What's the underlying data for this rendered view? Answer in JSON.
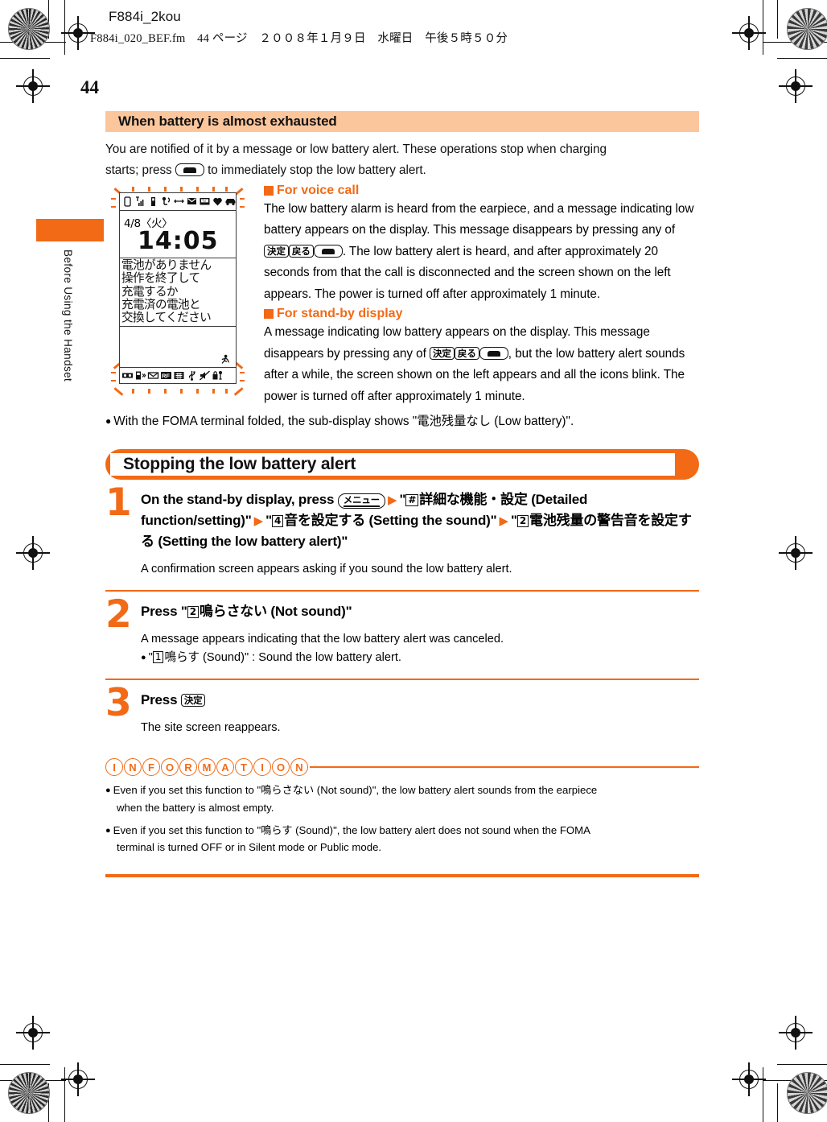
{
  "print_header": {
    "job_name": "F884i_2kou",
    "file_line": "F884i_020_BEF.fm　44 ページ　２００８年１月９日　水曜日　午後５時５０分"
  },
  "folio": "44",
  "sidebar": {
    "chapter_label": "Before Using the Handset",
    "tab_color": "#f26a16"
  },
  "section_a": {
    "heading": "When battery is almost exhausted",
    "heading_bg": "#fcc69c",
    "intro_1": "You are notified of it by a message or low battery alert. These operations stop when charging",
    "intro_2a": "starts; press",
    "intro_2b": "to immediately stop the low battery alert.",
    "sub1": {
      "title": "For voice call",
      "text_a": "The low battery alarm is heard from the earpiece, and a message indicating low battery appears on the display. This message disappears by pressing any of",
      "key1": "決定",
      "key2": "戻る",
      "text_b": ". The low battery alert is heard, and after approximately 20 seconds from that the call is disconnected and the screen shown on the left appears. The power is turned off after approximately 1 minute."
    },
    "sub2": {
      "title": "For stand-by display",
      "text_a": "A message indicating low battery appears on the display. This message disappears by pressing any of",
      "key1": "決定",
      "key2": "戻る",
      "text_b": ", but the low battery alert sounds after a while, the screen shown on the left appears and all the icons blink. The power is turned off after approximately 1 minute."
    },
    "note": "With the FOMA terminal folded, the sub-display shows \"電池残量なし (Low battery)\"."
  },
  "phone_screen": {
    "date": "4/8〈火〉",
    "time": "14:05",
    "message_lines": [
      "電池がありません",
      "操作を終了して",
      "充電するか",
      "充電済の電池と",
      "交換してください"
    ],
    "status_icons": [
      "battery-icon",
      "signal-bars-icon",
      "vibrate-icon",
      "earphone-icon",
      "transfer-icon",
      "mail-icon",
      "tv-icon",
      "heart-icon",
      "car-icon"
    ],
    "soft_icons": [
      "memo-icon",
      "phonebook-icon",
      "mail-soft-icon",
      "reading-frame-icon",
      "calendar-icon",
      "usb-icon",
      "mute-icon",
      "lock-icon"
    ],
    "runner_icon": "runner-icon",
    "blink_color": "#f26a16"
  },
  "section_b": {
    "heading": "Stopping the low battery alert",
    "heading_bg": "#f26a16",
    "steps": [
      {
        "num": "1",
        "title_a": "On the stand-by display, press",
        "key_menu": "メニュー",
        "q1_key": "#",
        "q1_text": "詳細な機能・設定 (Detailed function/setting)",
        "q2_key": "4",
        "q2_text": "音を設定する (Setting the sound)",
        "q3_key": "2",
        "q3_text": "電池残量の警告音を設定する (Setting the low battery alert)",
        "desc": "A confirmation screen appears asking if you sound the low battery alert."
      },
      {
        "num": "2",
        "title_a": "Press",
        "q1_key": "2",
        "q1_text": "鳴らさない (Not sound)",
        "desc": "A message appears indicating that the low battery alert was canceled.",
        "bullet_key": "1",
        "bullet_text": "鳴らす (Sound)\" : Sound the low battery alert."
      },
      {
        "num": "3",
        "title_a": "Press",
        "key_ok": "決定",
        "desc": "The site screen reappears."
      }
    ]
  },
  "information": {
    "label_letters": [
      "I",
      "N",
      "F",
      "O",
      "R",
      "M",
      "A",
      "T",
      "I",
      "O",
      "N"
    ],
    "items": [
      {
        "line1": "Even if you set this function to \"鳴らさない (Not sound)\", the low battery alert sounds from the earpiece",
        "line2": "when the battery is almost empty."
      },
      {
        "line1": "Even if you set this function to \"鳴らす (Sound)\", the low battery alert does not sound when the FOMA",
        "line2": "terminal is turned OFF or in Silent mode or Public mode."
      }
    ]
  },
  "colors": {
    "accent_orange": "#f26a16",
    "peach": "#fcc69c",
    "text": "#111111"
  }
}
